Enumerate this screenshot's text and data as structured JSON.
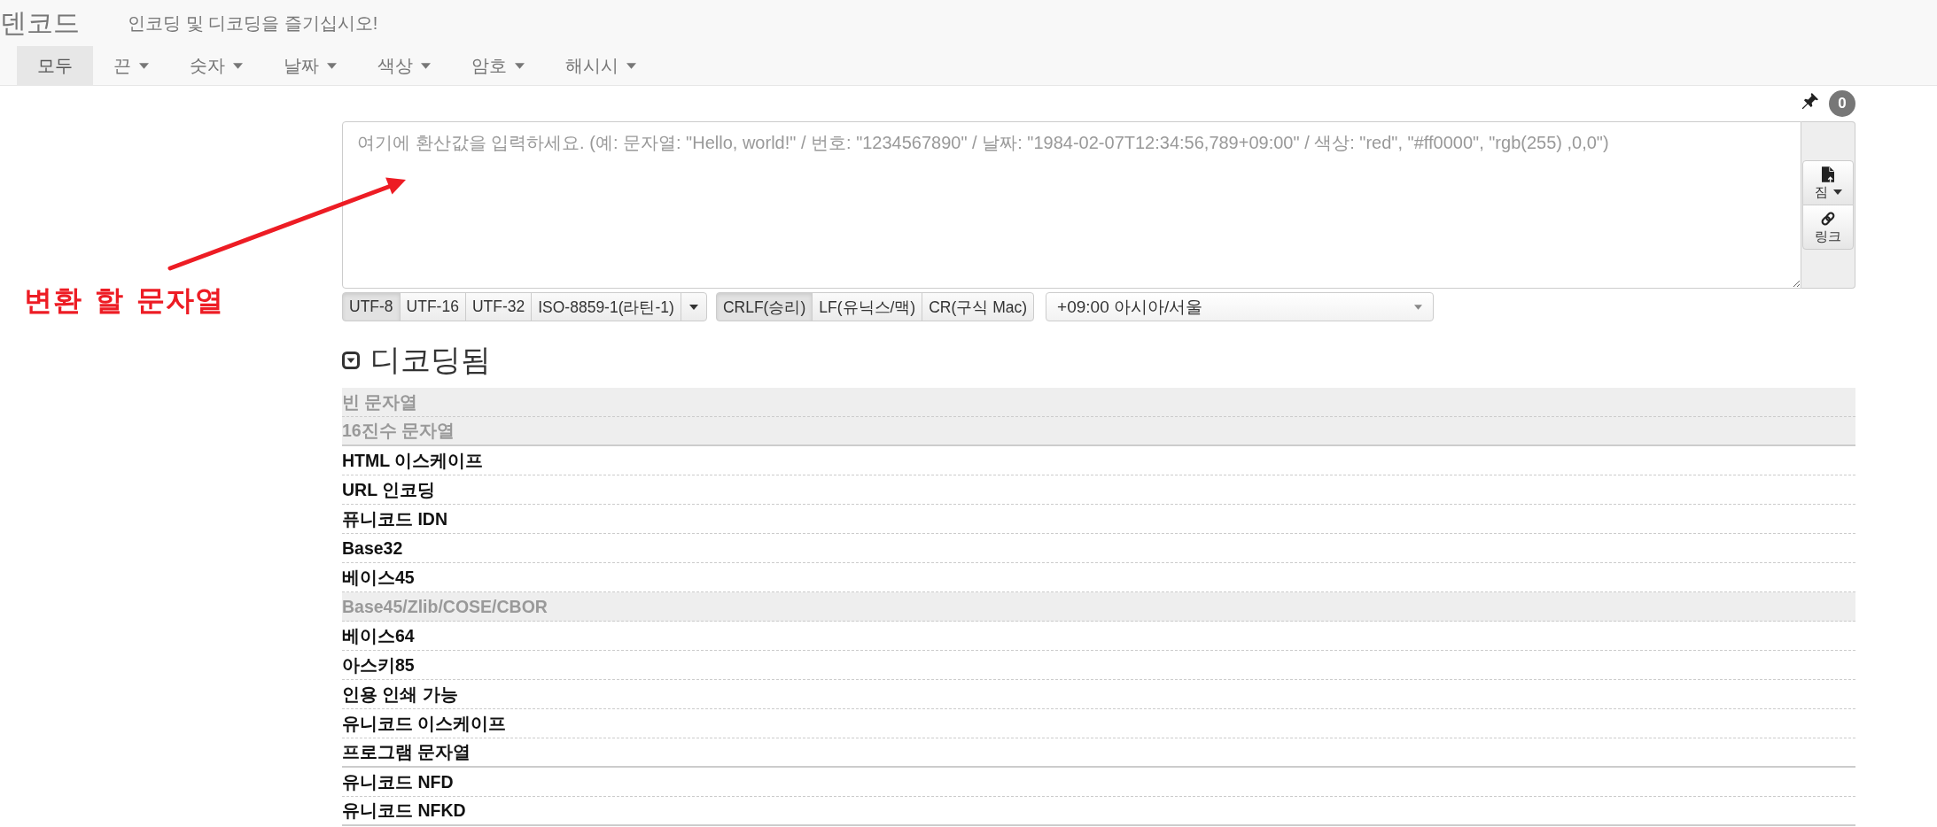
{
  "header": {
    "brand": "덴코드",
    "tagline": "인코딩 및 디코딩을 즐기십시오!",
    "tabs": [
      {
        "label": "모두",
        "kind": "link",
        "selected": true
      },
      {
        "label": "끈",
        "kind": "dropdown",
        "selected": false
      },
      {
        "label": "숫자",
        "kind": "dropdown",
        "selected": false
      },
      {
        "label": "날짜",
        "kind": "dropdown",
        "selected": false
      },
      {
        "label": "색상",
        "kind": "dropdown",
        "selected": false
      },
      {
        "label": "암호",
        "kind": "dropdown",
        "selected": false
      },
      {
        "label": "해시시",
        "kind": "dropdown",
        "selected": false
      }
    ]
  },
  "input": {
    "pinned_count": "0",
    "placeholder": "여기에 환산값을 입력하세요. (예: 문자열: \"Hello, world!\" / 번호: \"1234567890\" / 날짜: \"1984-02-07T12:34:56,789+09:00\" / 색상: \"red\", \"#ff0000\", \"rgb(255) ,0,0\")",
    "tools": [
      {
        "label": "짐",
        "kind": "menu"
      },
      {
        "label": "링크",
        "kind": "link"
      }
    ]
  },
  "options": {
    "encodings": [
      {
        "label": "UTF-8",
        "selected": true
      },
      {
        "label": "UTF-16",
        "selected": false
      },
      {
        "label": "UTF-32",
        "selected": false
      },
      {
        "label": "ISO-8859-1(라틴-1)",
        "selected": false
      }
    ],
    "newlines": [
      {
        "label": "CRLF(승리)",
        "selected": true
      },
      {
        "label": "LF(유닉스/맥)",
        "selected": false
      },
      {
        "label": "CR(구식 Mac)",
        "selected": false
      }
    ],
    "timezone": "+09:00 아시아/서울"
  },
  "decoded": {
    "title": "디코딩됨",
    "expanded": true,
    "groups": [
      {
        "items": [
          {
            "label": "빈 문자열",
            "disabled": true
          },
          {
            "label": "16진수 문자열",
            "disabled": true
          }
        ]
      },
      {
        "items": [
          {
            "label": "HTML 이스케이프",
            "disabled": false
          },
          {
            "label": "URL 인코딩",
            "disabled": false
          },
          {
            "label": "퓨니코드 IDN",
            "disabled": false
          },
          {
            "label": "Base32",
            "disabled": false
          },
          {
            "label": "베이스45",
            "disabled": false
          },
          {
            "label": "Base45/Zlib/COSE/CBOR",
            "disabled": true
          },
          {
            "label": "베이스64",
            "disabled": false
          },
          {
            "label": "아스키85",
            "disabled": false
          },
          {
            "label": "인용 인쇄 가능",
            "disabled": false
          },
          {
            "label": "유니코드 이스케이프",
            "disabled": false
          },
          {
            "label": "프로그램 문자열",
            "disabled": false
          }
        ]
      },
      {
        "items": [
          {
            "label": "유니코드 NFD",
            "disabled": false
          },
          {
            "label": "유니코드 NFKD",
            "disabled": false
          }
        ]
      }
    ]
  },
  "annotation": {
    "label": "변환 할 문자열"
  }
}
